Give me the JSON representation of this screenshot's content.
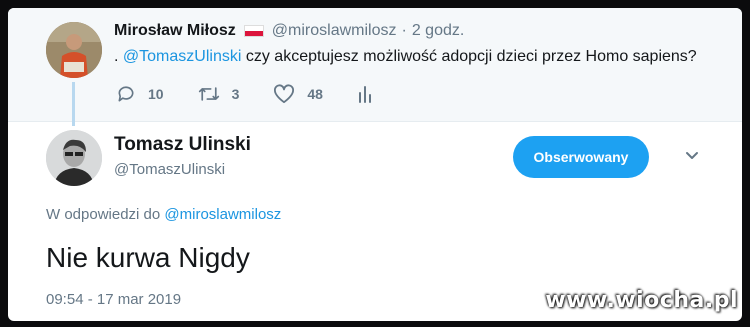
{
  "parent_tweet": {
    "author_name": "Mirosław Miłosz",
    "author_handle": "@miroslawmilosz",
    "separator": "·",
    "time": "2 godz.",
    "text_prefix": ".",
    "mention": "@TomaszUlinski",
    "text_body": "czy akceptujesz możliwość adopcji dzieci przez Homo sapiens?",
    "replies_count": "10",
    "retweets_count": "3",
    "likes_count": "48",
    "icons": {
      "reply": "reply-icon",
      "retweet": "retweet-icon",
      "like": "heart-icon",
      "analytics": "analytics-icon"
    }
  },
  "main_tweet": {
    "author_name": "Tomasz Ulinski",
    "author_handle": "@TomaszUlinski",
    "follow_button_label": "Obserwowany",
    "reply_label": "W odpowiedzi do",
    "reply_to_handle": "@miroslawmilosz",
    "text": "Nie kurwa Nigdy",
    "timestamp": "09:54 - 17 mar 2019"
  },
  "watermark": "www.wiocha.pl",
  "colors": {
    "accent": "#1da1f2",
    "link": "#1b95e0",
    "muted": "#657786",
    "text": "#14171a"
  }
}
